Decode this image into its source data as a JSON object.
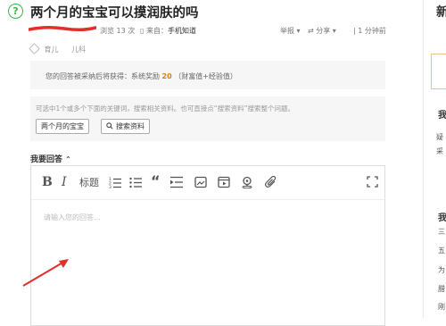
{
  "question": {
    "icon": "question-icon",
    "title": "两个月的宝宝可以摸润肤的吗",
    "views": "浏览 13 次",
    "source_prefix": "来自：",
    "source_link": "手机知道",
    "report": "举报",
    "share": "分享",
    "time": "1 分钟前",
    "tags": [
      "育儿",
      "儿科"
    ]
  },
  "reward": {
    "text_before": "您的回答被采纳后将获得：系统奖励",
    "amount": "20",
    "text_after": "（财富值+经验值）"
  },
  "keywords": {
    "hint": "可选中1个或多个下面的关键词，搜索相关资料。也可直接点“搜索资料”搜索整个问题。",
    "keyword_button": "两个月的宝宝",
    "search_button": "搜索资料"
  },
  "editor": {
    "label": "我要回答",
    "heading_label": "标题",
    "placeholder": "请输入您的回答..."
  },
  "sidebar": {
    "top_char": "新",
    "items": [
      "我",
      "疑",
      "采",
      "我",
      "三",
      "五",
      "为",
      "腊",
      "刚"
    ]
  },
  "colors": {
    "accent_green": "#3fb449",
    "reward_orange": "#e37c00",
    "annotation_red": "#e0302a"
  }
}
